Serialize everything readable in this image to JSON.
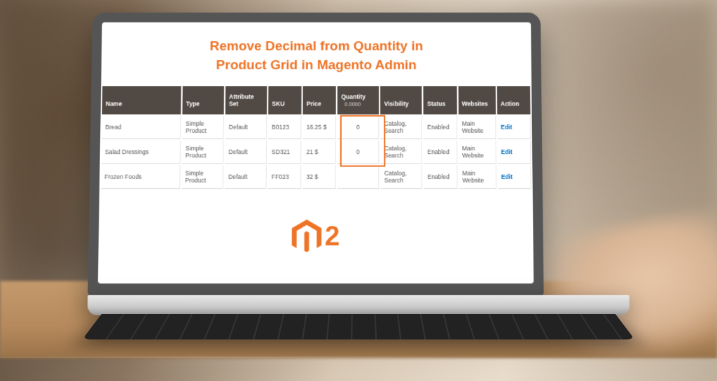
{
  "title_line1": "Remove Decimal from Quantity in",
  "title_line2": "Product Grid in Magento Admin",
  "logo_suffix": "2",
  "columns": {
    "name": "Name",
    "type": "Type",
    "attr": "Attribute Set",
    "sku": "SKU",
    "price": "Price",
    "qty": "Quantity",
    "vis": "Visibility",
    "status": "Status",
    "web": "Websites",
    "action": "Action"
  },
  "header_qty_value": "0.0000",
  "rows": [
    {
      "name": "Bread",
      "type": "Simple Product",
      "attr": "Default",
      "sku": "B0123",
      "price": "16.25 $",
      "qty": "0",
      "vis": "Catalog, Search",
      "status": "Enabled",
      "web": "Main Website",
      "action": "Edit"
    },
    {
      "name": "Salad Dressings",
      "type": "Simple Product",
      "attr": "Default",
      "sku": "SD321",
      "price": "21 $",
      "qty": "0",
      "vis": "Catalog, Search",
      "status": "Enabled",
      "web": "Main Website",
      "action": "Edit"
    },
    {
      "name": "Frozen Foods",
      "type": "Simple Product",
      "attr": "Default",
      "sku": "FF023",
      "price": "32 $",
      "qty": "",
      "vis": "Catalog, Search",
      "status": "Enabled",
      "web": "Main Website",
      "action": "Edit"
    }
  ]
}
